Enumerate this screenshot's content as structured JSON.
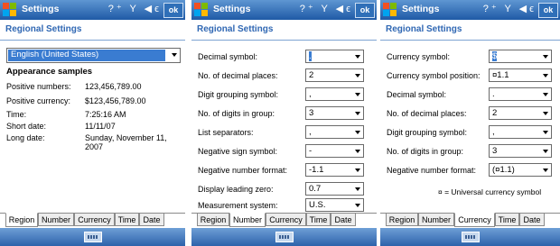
{
  "panels": [
    {
      "title": "Settings",
      "status": "?⁺ Y ◀ϵ",
      "ok": "ok",
      "header": "Regional Settings",
      "locale": "English (United States)",
      "samples_heading": "Appearance samples",
      "samples": [
        {
          "label": "Positive numbers:",
          "value": "123,456,789.00"
        },
        {
          "label": "Positive currency:",
          "value": "$123,456,789.00"
        },
        {
          "label": "Time:",
          "value": "7:25:16 AM"
        },
        {
          "label": "Short date:",
          "value": "11/11/07"
        },
        {
          "label": "Long date:",
          "value": "Sunday, November 11, 2007"
        }
      ],
      "tabs": [
        "Region",
        "Number",
        "Currency",
        "Time",
        "Date"
      ]
    },
    {
      "title": "Settings",
      "status": "?⁺ Y ◀ϵ",
      "ok": "ok",
      "header": "Regional Settings",
      "fields": [
        {
          "label": "Decimal symbol:",
          "value": "."
        },
        {
          "label": "No. of decimal places:",
          "value": "2"
        },
        {
          "label": "Digit grouping symbol:",
          "value": ","
        },
        {
          "label": "No. of digits in group:",
          "value": "3"
        },
        {
          "label": "List separators:",
          "value": ","
        },
        {
          "label": "Negative sign symbol:",
          "value": "-"
        },
        {
          "label": "Negative number format:",
          "value": "-1.1"
        },
        {
          "label": "Display leading zero:",
          "value": "0.7"
        },
        {
          "label": "Measurement system:",
          "value": "U.S."
        }
      ],
      "tabs": [
        "Region",
        "Number",
        "Currency",
        "Time",
        "Date"
      ]
    },
    {
      "title": "Settings",
      "status": "?⁺ Y ◀ϵ",
      "ok": "ok",
      "header": "Regional Settings",
      "fields": [
        {
          "label": "Currency symbol:",
          "value": "$"
        },
        {
          "label": "Currency symbol position:",
          "value": "¤1.1"
        },
        {
          "label": "Decimal symbol:",
          "value": "."
        },
        {
          "label": "No. of decimal places:",
          "value": "2"
        },
        {
          "label": "Digit grouping symbol:",
          "value": ","
        },
        {
          "label": "No. of digits in group:",
          "value": "3"
        },
        {
          "label": "Negative number format:",
          "value": "(¤1.1)"
        }
      ],
      "note": "¤ = Universal currency symbol",
      "tabs": [
        "Region",
        "Number",
        "Currency",
        "Time",
        "Date"
      ]
    }
  ],
  "colors": {
    "accent": "#2f67b3",
    "titlebar": "#1f5aa6",
    "selection": "#3a7cd1"
  },
  "icons": [
    "windows-start-icon",
    "connectivity-icon",
    "signal-icon",
    "volume-icon",
    "keyboard-icon"
  ]
}
